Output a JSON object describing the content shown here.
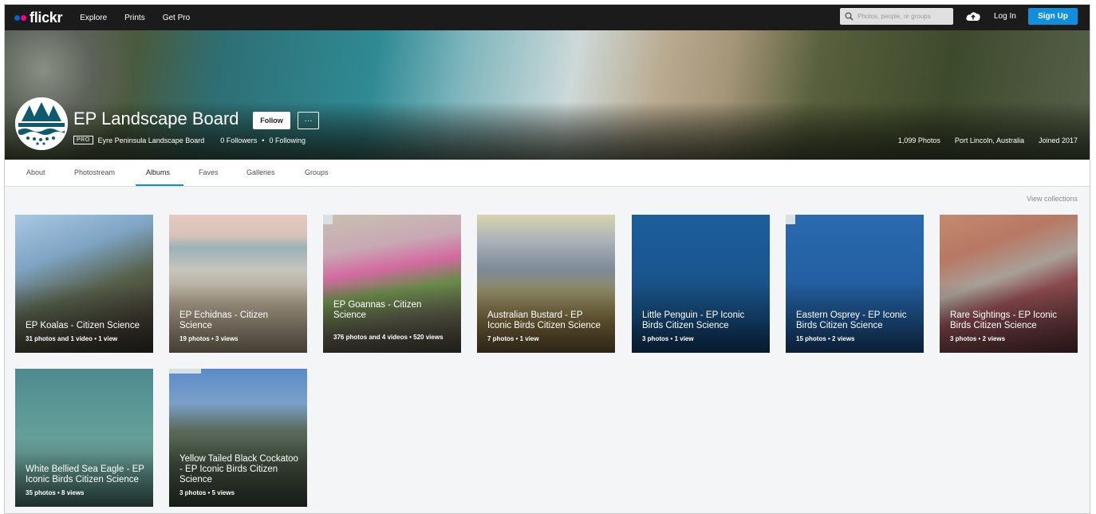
{
  "nav": {
    "logo": "flickr",
    "links": [
      "Explore",
      "Prints",
      "Get Pro"
    ],
    "search_placeholder": "Photos, people, or groups",
    "login": "Log In",
    "signup": "Sign Up"
  },
  "profile": {
    "name": "EP Landscape Board",
    "follow": "Follow",
    "more": "···",
    "pro_badge": "PRO",
    "real_name": "Eyre Peninsula Landscape Board",
    "followers": "0 Followers",
    "separator": "•",
    "following": "0 Following",
    "photos": "1,099 Photos",
    "location": "Port Lincoln, Australia",
    "joined": "Joined 2017"
  },
  "tabs": [
    "About",
    "Photostream",
    "Albums",
    "Faves",
    "Galleries",
    "Groups"
  ],
  "active_tab": "Albums",
  "view_collections": "View collections",
  "albums": [
    {
      "title": "EP Koalas - Citizen Science",
      "meta": "31 photos and 1 video  •  1 view"
    },
    {
      "title": "EP Echidnas - Citizen Science",
      "meta": "19 photos  •  3 views"
    },
    {
      "title": "EP Goannas - Citizen Science",
      "meta": "376 photos and 4 videos  •  520 views"
    },
    {
      "title": "Australian Bustard - EP Iconic Birds Citizen Science",
      "meta": "7 photos  •  1 view"
    },
    {
      "title": "Little Penguin - EP Iconic Birds Citizen Science",
      "meta": "3 photos  •  1 view"
    },
    {
      "title": "Eastern Osprey - EP Iconic Birds Citizen Science",
      "meta": "15 photos  •  2 views"
    },
    {
      "title": "Rare Sightings - EP Iconic Birds Citizen Science",
      "meta": "3 photos  •  2 views"
    },
    {
      "title": "White Bellied Sea Eagle - EP Iconic Birds Citizen Science",
      "meta": "35 photos  •  8 views"
    },
    {
      "title": "Yellow Tailed Black Cockatoo - EP Iconic Birds Citizen Science",
      "meta": "3 photos  •  5 views"
    }
  ],
  "colors": {
    "topnav_bg": "#1b1b1b",
    "accent_blue": "#128fdc",
    "logo_blue": "#0063dc",
    "logo_pink": "#ff0084",
    "page_bg": "#f3f5f6"
  }
}
